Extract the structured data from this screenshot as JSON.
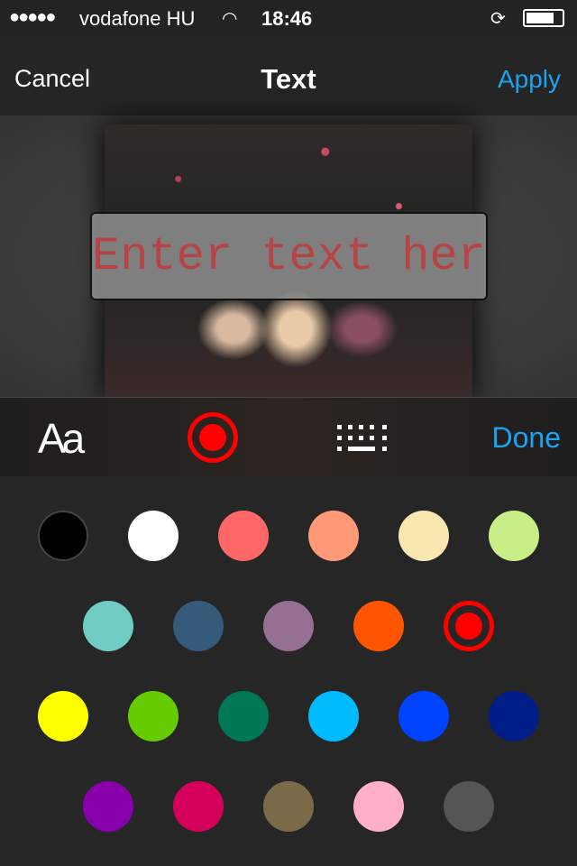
{
  "status": {
    "carrier": "vodafone HU",
    "time": "18:46",
    "signal_dots": 5,
    "battery_level": 0.8
  },
  "nav": {
    "cancel": "Cancel",
    "title": "Text",
    "apply": "Apply"
  },
  "editor": {
    "placeholder": "Enter text here",
    "text_color": "#c03a3a"
  },
  "toolbar": {
    "font_icon": "Aa",
    "done": "Done",
    "selected_color": "#ff0000"
  },
  "palette": {
    "rows": [
      [
        "#000000",
        "#ffffff",
        "#ff6666",
        "#ff9977",
        "#f8e8b0",
        "#c8ee88"
      ],
      [
        "#70ccc4",
        "#355a7a",
        "#967092",
        "#ff5500",
        "#ff0000"
      ],
      [
        "#ffff00",
        "#66cc00",
        "#007755",
        "#00bbff",
        "#0044ff",
        "#001e88"
      ],
      [
        "#8800aa",
        "#d4005a",
        "#7a6a48",
        "#ffb0c8",
        "#555555"
      ]
    ],
    "selected": "#ff0000"
  }
}
